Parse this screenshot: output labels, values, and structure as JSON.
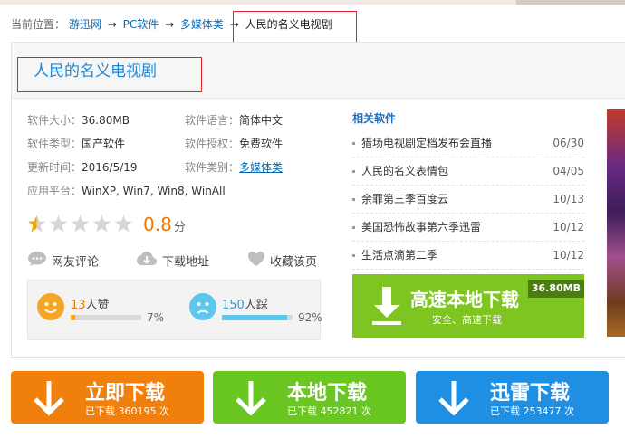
{
  "breadcrumb": {
    "label": "当前位置：",
    "items": [
      "游迅网",
      "PC软件",
      "多媒体类"
    ],
    "current": "人民的名义电视剧",
    "sep": "→"
  },
  "title": "人民的名义电视剧",
  "info": {
    "size_k": "软件大小：",
    "size_v": "36.80MB",
    "lang_k": "软件语言：",
    "lang_v": "简体中文",
    "type_k": "软件类型：",
    "type_v": "国产软件",
    "license_k": "软件授权：",
    "license_v": "免费软件",
    "update_k": "更新时间：",
    "update_v": "2016/5/19",
    "cat_k": "软件类别：",
    "cat_v": "多媒体类",
    "platform_k": "应用平台：",
    "platform_v": "WinXP, Win7, Win8, WinAll"
  },
  "rating": {
    "stars": 0.5,
    "max": 5,
    "score": "0.8",
    "unit": "分"
  },
  "actions": {
    "comment": "网友评论",
    "download_addr": "下载地址",
    "favorite": "收藏该页"
  },
  "votes": {
    "up_count": "13",
    "up_label": "人赞",
    "up_pct": "7%",
    "up_ratio": 0.07,
    "down_count": "150",
    "down_label": "人踩",
    "down_pct": "92%",
    "down_ratio": 0.92
  },
  "related": {
    "heading": "相关软件",
    "items": [
      {
        "title": "猎场电视剧定档发布会直播",
        "date": "06/30"
      },
      {
        "title": "人民的名义表情包",
        "date": "04/05"
      },
      {
        "title": "余罪第三季百度云",
        "date": "10/13"
      },
      {
        "title": "美国恐怖故事第六季迅雷",
        "date": "10/12"
      },
      {
        "title": "生活点滴第二季",
        "date": "10/12"
      }
    ]
  },
  "fast_download": {
    "title": "高速本地下载",
    "sub": "安全、高速下载",
    "size": "36.80MB"
  },
  "buttons": [
    {
      "title": "立即下载",
      "sub": "已下载 360195 次",
      "color": "#f07f0b"
    },
    {
      "title": "本地下载",
      "sub": "已下载 452821 次",
      "color": "#6ac722"
    },
    {
      "title": "迅雷下载",
      "sub": "已下载 253477 次",
      "color": "#1f8fe3"
    }
  ]
}
